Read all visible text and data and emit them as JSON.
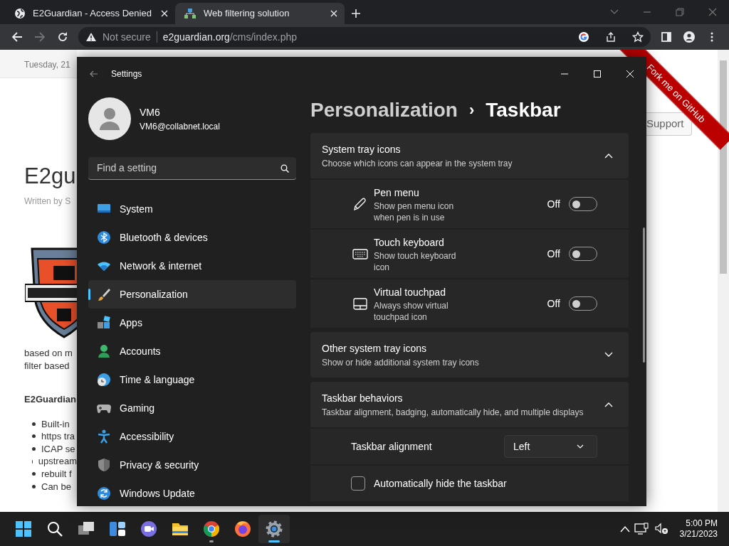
{
  "browser": {
    "tabs": [
      {
        "title": "E2Guardian - Access Denied",
        "selected": false
      },
      {
        "title": "Web filtering solution",
        "selected": true
      }
    ],
    "toolbar": {
      "back_disabled": false,
      "forward_disabled": true
    },
    "address": {
      "security": "Not secure",
      "host": "e2guardian.org",
      "path": "/cms/index.php"
    }
  },
  "webpage": {
    "date": "Tuesday, 21",
    "title": "E2gu",
    "byline": "Written by S",
    "paragraph_lines": [
      "based on m",
      "filter based"
    ],
    "heading": "E2Guardian",
    "bullets": [
      "Built-in",
      "https tra",
      "ICAP se",
      "upstream",
      "rebuilt f",
      "Can be"
    ],
    "support_button": "Support",
    "ribbon": "Fork me on GitHub"
  },
  "settings": {
    "title": "Settings",
    "user": {
      "name": "VM6",
      "email": "VM6@collabnet.local"
    },
    "search": {
      "placeholder": "Find a setting"
    },
    "nav": [
      {
        "label": "System",
        "selected": false
      },
      {
        "label": "Bluetooth & devices",
        "selected": false
      },
      {
        "label": "Network & internet",
        "selected": false
      },
      {
        "label": "Personalization",
        "selected": true
      },
      {
        "label": "Apps",
        "selected": false
      },
      {
        "label": "Accounts",
        "selected": false
      },
      {
        "label": "Time & language",
        "selected": false
      },
      {
        "label": "Gaming",
        "selected": false
      },
      {
        "label": "Accessibility",
        "selected": false
      },
      {
        "label": "Privacy & security",
        "selected": false
      },
      {
        "label": "Windows Update",
        "selected": false
      }
    ],
    "breadcrumb": {
      "parent": "Personalization",
      "separator": "›",
      "current": "Taskbar"
    },
    "sections": [
      {
        "title": "System tray icons",
        "subtitle": "Choose which icons can appear in the system tray",
        "expanded": true,
        "items": [
          {
            "kind": "toggle",
            "title": "Pen menu",
            "description": "Show pen menu icon when pen is in use",
            "on": false,
            "state_label": "Off"
          },
          {
            "kind": "toggle",
            "title": "Touch keyboard",
            "description": "Show touch keyboard icon",
            "on": false,
            "state_label": "Off"
          },
          {
            "kind": "toggle",
            "title": "Virtual touchpad",
            "description": "Always show virtual touchpad icon",
            "on": false,
            "state_label": "Off"
          }
        ]
      },
      {
        "title": "Other system tray icons",
        "subtitle": "Show or hide additional system tray icons",
        "expanded": false
      },
      {
        "title": "Taskbar behaviors",
        "subtitle": "Taskbar alignment, badging, automatically hide, and multiple displays",
        "expanded": true,
        "items": [
          {
            "kind": "dropdown",
            "title": "Taskbar alignment",
            "value": "Left"
          },
          {
            "kind": "checkbox",
            "title": "Automatically hide the taskbar",
            "checked": false
          }
        ]
      }
    ]
  },
  "taskbar": {
    "apps": [
      {
        "kind": "start",
        "active": false,
        "running": false
      },
      {
        "kind": "search",
        "active": false,
        "running": false
      },
      {
        "kind": "taskview",
        "active": false,
        "running": false
      },
      {
        "kind": "widgets",
        "active": false,
        "running": false
      },
      {
        "kind": "chat",
        "active": false,
        "running": false
      },
      {
        "kind": "explorer",
        "active": false,
        "running": false
      },
      {
        "kind": "chrome",
        "active": false,
        "running": true
      },
      {
        "kind": "firefox",
        "active": false,
        "running": false
      },
      {
        "kind": "settings",
        "active": true,
        "running": true
      }
    ],
    "time": "5:00 PM",
    "date": "3/21/2023"
  }
}
